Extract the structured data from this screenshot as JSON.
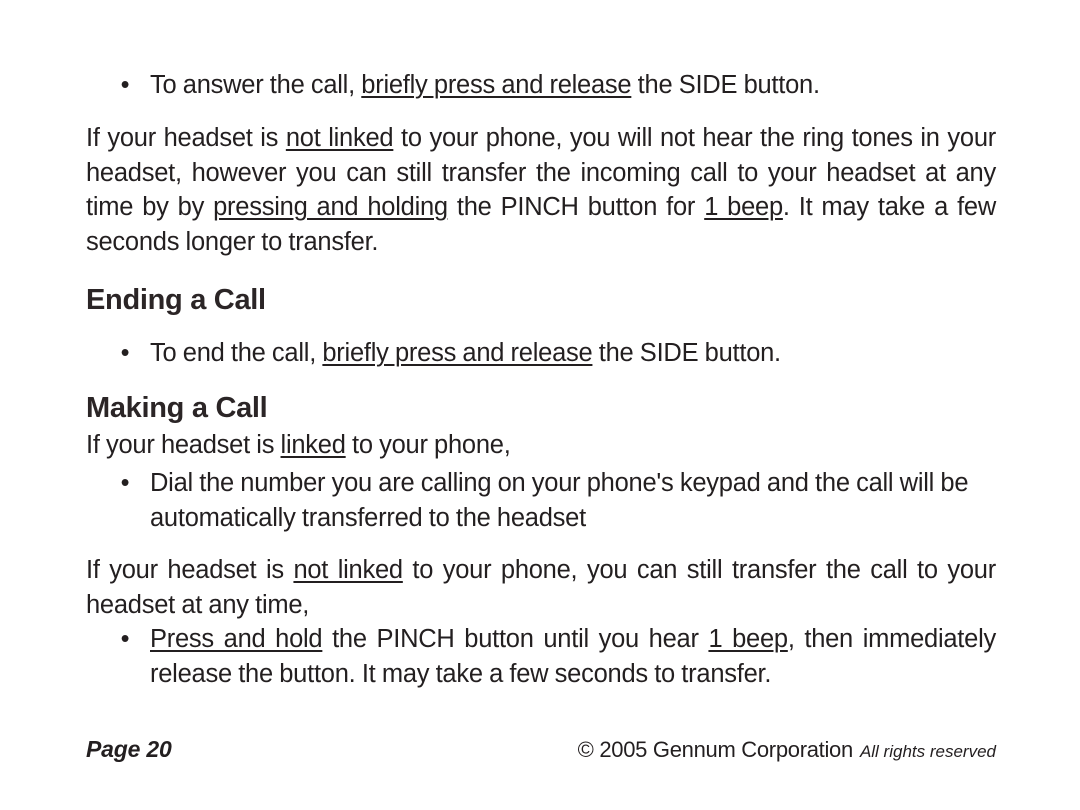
{
  "document": {
    "page_number_label": "Page 20",
    "copyright": "© 2005 Gennum Corporation",
    "rights": "All rights reserved"
  },
  "blocks": {
    "answer_bullet": {
      "bullet_glyph": "•",
      "text_before": "To answer the call, ",
      "underlined": "briefly press and release",
      "text_after": " the SIDE button."
    },
    "not_linked_paragraph": {
      "seg1": "If your headset is ",
      "underlined1": "not linked",
      "seg2": " to your phone, you will not hear the ring tones in your headset, however you can still transfer the incoming call to your headset at any time by by ",
      "underlined2": "pressing and holding",
      "seg3": " the PINCH button for ",
      "underlined3": "1 beep",
      "seg4": ". It may take a few seconds longer to transfer."
    },
    "ending_heading": "Ending a Call",
    "end_bullet": {
      "bullet_glyph": "•",
      "text_before": "To end the call, ",
      "underlined": "briefly press and release",
      "text_after": " the SIDE button."
    },
    "making_heading": "Making a Call",
    "linked_paragraph": {
      "seg1": "If your headset is ",
      "underlined1": "linked",
      "seg2": " to your phone,"
    },
    "dial_bullet": {
      "bullet_glyph": "•",
      "text": "Dial the number you are calling on your phone's keypad and the call will be automatically transferred to the headset"
    },
    "transfer_paragraph": {
      "seg1": "If your headset is ",
      "underlined1": "not linked",
      "seg2": " to your phone, you can still transfer the call to your headset at any time,"
    },
    "press_hold_bullet": {
      "bullet_glyph": "•",
      "underlined1": "Press and hold",
      "seg1": " the PINCH button until you hear ",
      "underlined2": "1 beep",
      "seg2": ", then immediately release the button.  It may take a few seconds to transfer."
    }
  },
  "colors": {
    "text": "#231f20",
    "heading": "#2b2526",
    "background": "#ffffff"
  }
}
